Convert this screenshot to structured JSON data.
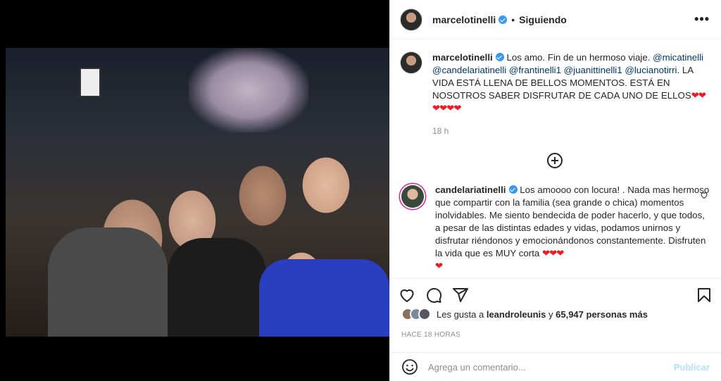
{
  "post": {
    "author": "marcelotinelli",
    "follow_status": "Siguiendo",
    "dot": "•",
    "more_icon": "ellipsis-icon",
    "caption": {
      "username": "marcelotinelli",
      "text_start": "Los amo. Fin de un hermoso viaje.",
      "mentions": [
        "@micatinelli",
        "@candelariatinelli",
        "@frantinelli1",
        "@juanittinelli1",
        "@lucianotirri"
      ],
      "text_end": ". LA VIDA ESTÁ LLENA DE BELLOS MOMENTOS. ESTÁ EN NOSOTROS SABER DISFRUTAR DE CADA UNO DE ELLOS",
      "hearts": "❤❤❤❤❤❤",
      "time": "18 h"
    },
    "comment": {
      "username": "candelariatinelli",
      "text": "Los amoooo con locura! . Nada mas hermoso que compartir con la familia (sea grande o chica) momentos inolvidables. Me siento bendecida de poder hacerlo, y que todos, a pesar de las distintas edades y vidas, podamos unirnos y disfrutar riéndonos y emocionándonos constantemente. Disfruten la vida que es MUY corta",
      "hearts": "❤❤❤",
      "hearts2": "❤"
    },
    "likes": {
      "prefix": "Les gusta a",
      "user": "leandroleunis",
      "conj": "y",
      "count": "65,947 personas más"
    },
    "ago": "HACE 18 HORAS",
    "composer": {
      "placeholder": "Agrega un comentario...",
      "publish": "Publicar"
    }
  },
  "colors": {
    "verified": "#3897f0",
    "mention": "#00376b",
    "heart": "#ed1c24",
    "publish": "#b2dffc",
    "muted": "#8e8e8e"
  }
}
